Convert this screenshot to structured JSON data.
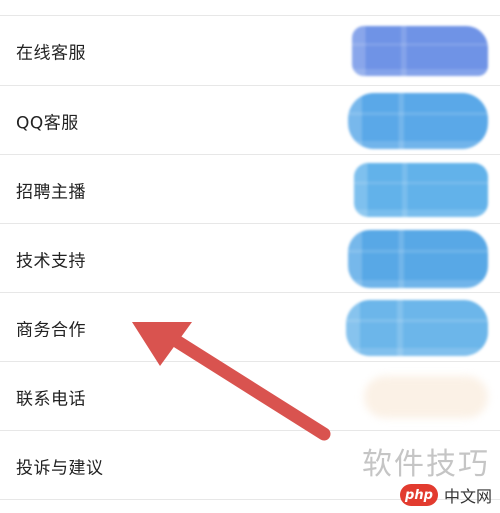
{
  "menu": {
    "items": [
      {
        "label": "在线客服",
        "value_color": "#6f93e6"
      },
      {
        "label": "QQ客服",
        "value_color": "#5aa8e8"
      },
      {
        "label": "招聘主播",
        "value_color": "#62b2ea"
      },
      {
        "label": "技术支持",
        "value_color": "#58a8e6"
      },
      {
        "label": "商务合作",
        "value_color": "#6cb6ea"
      },
      {
        "label": "联系电话",
        "value_color": "#fbf1e6"
      },
      {
        "label": "投诉与建议",
        "value_color": ""
      }
    ]
  },
  "annotation": {
    "color": "#d9534f"
  },
  "watermark": {
    "text": "软件技巧"
  },
  "brand": {
    "logo_text": "php",
    "site_text": "中文网",
    "logo_color": "#e23b2f"
  }
}
